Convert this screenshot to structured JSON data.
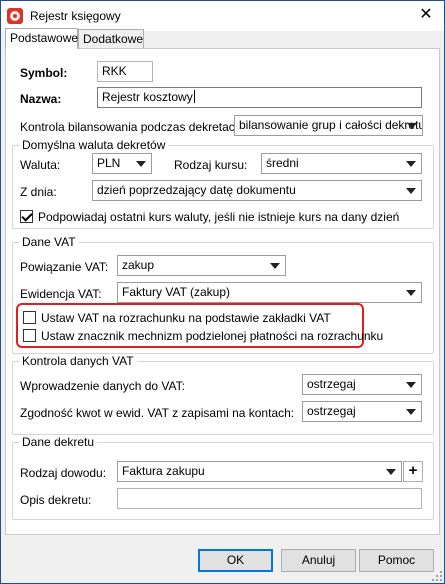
{
  "window": {
    "title": "Rejestr księgowy",
    "close_glyph": "✕"
  },
  "tabs": [
    {
      "label": "Podstawowe",
      "active": true
    },
    {
      "label": "Dodatkowe",
      "active": false
    }
  ],
  "form": {
    "symbol": {
      "label": "Symbol:",
      "value": "RKK"
    },
    "nazwa": {
      "label": "Nazwa:",
      "value": "Rejestr kosztowy"
    },
    "kontrola_bilansowania": {
      "label": "Kontrola bilansowania podczas dekretacji:",
      "value": "bilansowanie grup i całości dekretu"
    }
  },
  "waluta_group": {
    "title": "Domyślna waluta dekretów",
    "waluta": {
      "label": "Waluta:",
      "value": "PLN"
    },
    "rodzaj_kursu": {
      "label": "Rodzaj kursu:",
      "value": "średni"
    },
    "z_dnia": {
      "label": "Z dnia:",
      "value": "dzień poprzedzający datę dokumentu"
    },
    "podpowiadaj": {
      "label": "Podpowiadaj ostatni kurs waluty, jeśli nie istnieje kurs na dany dzień",
      "checked": true
    }
  },
  "vat_group": {
    "title": "Dane VAT",
    "powiazanie": {
      "label": "Powiązanie VAT:",
      "value": "zakup"
    },
    "ewidencja": {
      "label": "Ewidencja VAT:",
      "value": "Faktury VAT (zakup)"
    },
    "ustaw_vat": {
      "label": "Ustaw VAT na rozrachunku na podstawie zakładki VAT",
      "checked": false
    },
    "ustaw_znacznik": {
      "label": "Ustaw znacznik mechnizm podzielonej płatności na rozrachunku",
      "checked": false
    }
  },
  "kontrola_vat_group": {
    "title": "Kontrola danych VAT",
    "wprowadzenie": {
      "label": "Wprowadzenie danych do VAT:",
      "value": "ostrzegaj"
    },
    "zgodnosc": {
      "label": "Zgodność kwot w ewid. VAT z zapisami na kontach:",
      "value": "ostrzegaj"
    }
  },
  "dekret_group": {
    "title": "Dane dekretu",
    "rodzaj_dowodu": {
      "label": "Rodzaj dowodu:",
      "value": "Faktura zakupu",
      "add_glyph": "+"
    },
    "opis": {
      "label": "Opis dekretu:",
      "value": ""
    }
  },
  "buttons": {
    "ok": "OK",
    "anuluj": "Anuluj",
    "pomoc": "Pomoc"
  },
  "colors": {
    "highlight": "#e02020",
    "accent": "#0078d7"
  }
}
